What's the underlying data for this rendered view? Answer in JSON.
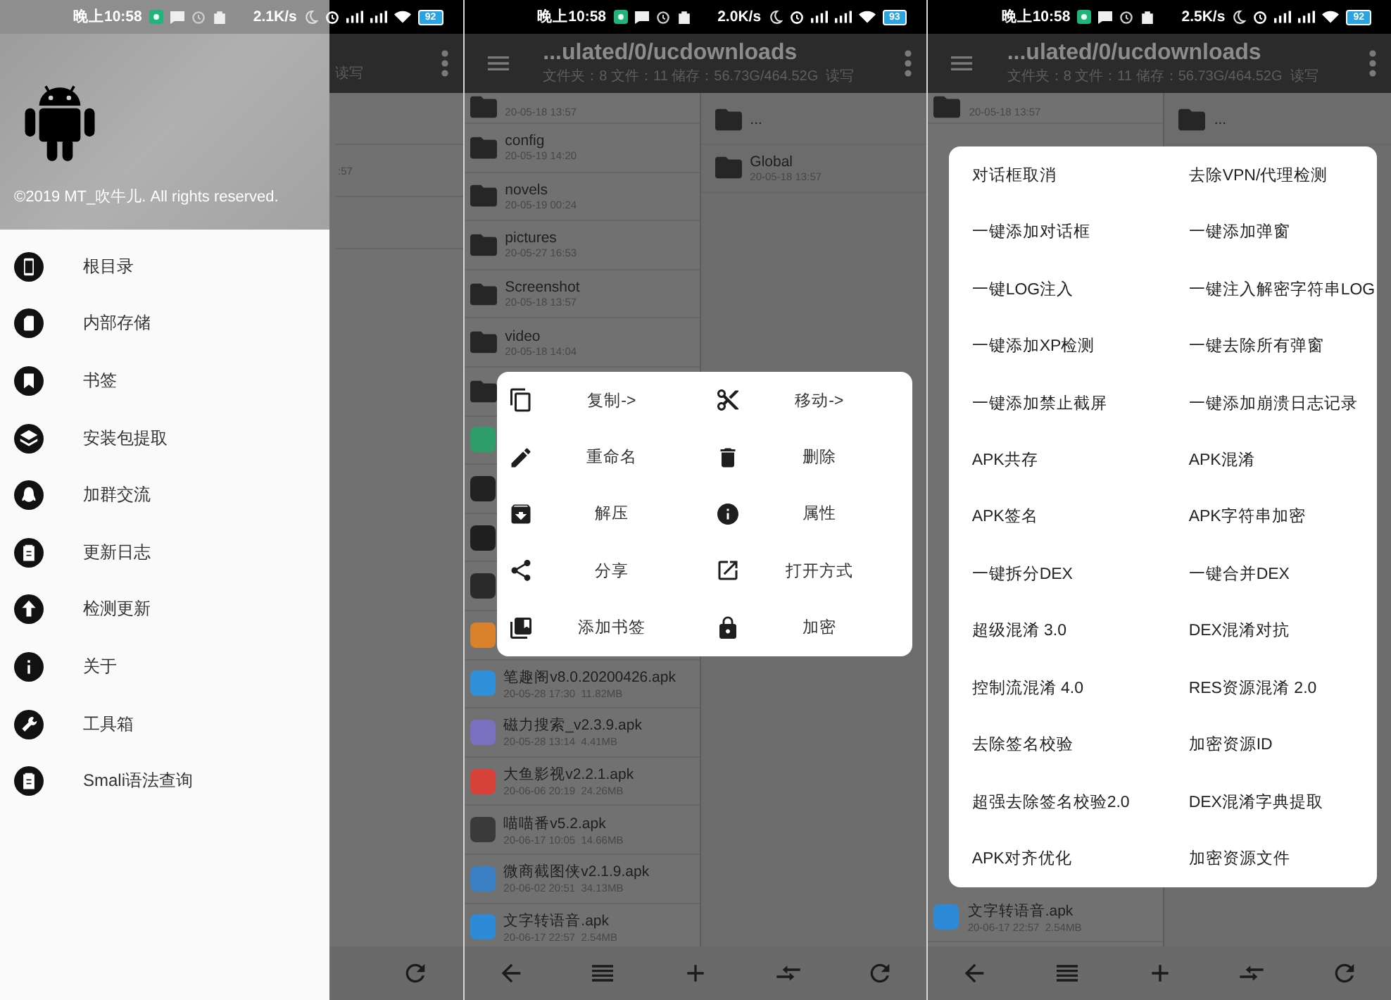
{
  "phones": [
    {
      "kind": "drawer",
      "status_bar": {
        "time": "晚上10:58",
        "speed": "2.1K/s",
        "battery": "92"
      },
      "behind": {
        "subtitle_fragment": "读写",
        "date_fragment": ":57"
      },
      "drawer": {
        "copyright": "©2019 MT_吹牛儿. All rights reserved.",
        "items": [
          {
            "label": "根目录"
          },
          {
            "label": "内部存储"
          },
          {
            "label": "书签"
          },
          {
            "label": "安装包提取"
          },
          {
            "label": "加群交流"
          },
          {
            "label": "更新日志"
          },
          {
            "label": "检测更新"
          },
          {
            "label": "关于"
          },
          {
            "label": "工具箱"
          },
          {
            "label": "Smali语法查询"
          }
        ]
      }
    },
    {
      "kind": "context_menu",
      "status_bar": {
        "time": "晚上10:58",
        "speed": "2.0K/s",
        "battery": "93"
      },
      "app_bar": {
        "title": "...ulated/0/ucdownloads",
        "subtitle": "文件夹：8 文件：11 储存：56.73G/464.52G  读写"
      },
      "left_pane": [
        {
          "kind": "folder",
          "date": "20-05-18 13:57"
        },
        {
          "kind": "folder",
          "name": "config",
          "date": "20-05-19 14:20"
        },
        {
          "kind": "folder",
          "name": "novels",
          "date": "20-05-19 00:24"
        },
        {
          "kind": "folder",
          "name": "pictures",
          "date": "20-05-27 16:53"
        },
        {
          "kind": "folder",
          "name": "Screenshot",
          "date": "20-05-18 13:57"
        },
        {
          "kind": "folder",
          "name": "video",
          "date": "20-05-18 14:04"
        },
        {
          "kind": "folder"
        },
        {
          "kind": "apk",
          "color": "#2e9d6a"
        },
        {
          "kind": "apk",
          "color": "#222222"
        },
        {
          "kind": "apk",
          "color": "#1f1f1f"
        },
        {
          "kind": "apk",
          "color": "#2a2a2a"
        },
        {
          "kind": "apk",
          "color": "#d9822b"
        },
        {
          "kind": "apk",
          "color": "#2f8fd8",
          "name": "笔趣阁v8.0.20200426.apk",
          "date": "20-05-28 17:30  11.82MB"
        },
        {
          "kind": "apk",
          "color": "#7b6fc0",
          "name": "磁力搜索_v2.3.9.apk",
          "date": "20-05-28 13:14  4.41MB"
        },
        {
          "kind": "apk",
          "color": "#d8403a",
          "name": "大鱼影视v2.2.1.apk",
          "date": "20-06-06 20:19  24.26MB"
        },
        {
          "kind": "apk",
          "color": "#3a3a3a",
          "name": "喵喵番v5.2.apk",
          "date": "20-06-17 10:05  14.66MB"
        },
        {
          "kind": "apk",
          "color": "#3b7fc4",
          "name": "微商截图侠v2.1.9.apk",
          "date": "20-06-02 20:51  34.13MB"
        },
        {
          "kind": "apk",
          "color": "#2d8ad6",
          "name": "文字转语音.apk",
          "date": "20-06-17 22:57  2.54MB"
        }
      ],
      "right_pane": [
        {
          "kind": "folder",
          "name": "..."
        },
        {
          "kind": "folder",
          "name": "Global",
          "date": "20-05-18 13:57"
        }
      ],
      "menu": {
        "items": [
          {
            "label": "复制->"
          },
          {
            "label": "移动->"
          },
          {
            "label": "重命名"
          },
          {
            "label": "删除"
          },
          {
            "label": "解压"
          },
          {
            "label": "属性"
          },
          {
            "label": "分享"
          },
          {
            "label": "打开方式"
          },
          {
            "label": "添加书签"
          },
          {
            "label": "加密"
          }
        ]
      }
    },
    {
      "kind": "list_menu",
      "status_bar": {
        "time": "晚上10:58",
        "speed": "2.5K/s",
        "battery": "92"
      },
      "app_bar": {
        "title": "...ulated/0/ucdownloads",
        "subtitle": "文件夹：8 文件：11 储存：56.73G/464.52G  读写"
      },
      "left_pane": [
        {
          "kind": "folder",
          "date": "20-05-18 13:57"
        },
        {
          "kind": "apk",
          "color": "#2d8ad6",
          "name": "文字转语音.apk",
          "date": "20-06-17 22:57  2.54MB"
        }
      ],
      "right_pane": [
        {
          "kind": "folder",
          "name": "..."
        }
      ],
      "menu": {
        "items": [
          {
            "label": "对话框取消"
          },
          {
            "label": "去除VPN/代理检测"
          },
          {
            "label": "一键添加对话框"
          },
          {
            "label": "一键添加弹窗"
          },
          {
            "label": "一键LOG注入"
          },
          {
            "label": "一键注入解密字符串LOG"
          },
          {
            "label": "一键添加XP检测"
          },
          {
            "label": "一键去除所有弹窗"
          },
          {
            "label": "一键添加禁止截屏"
          },
          {
            "label": "一键添加崩溃日志记录"
          },
          {
            "label": "APK共存"
          },
          {
            "label": "APK混淆"
          },
          {
            "label": "APK签名"
          },
          {
            "label": "APK字符串加密"
          },
          {
            "label": "一键拆分DEX"
          },
          {
            "label": "一键合并DEX"
          },
          {
            "label": "超级混淆 3.0"
          },
          {
            "label": "DEX混淆对抗"
          },
          {
            "label": "控制流混淆 4.0"
          },
          {
            "label": "RES资源混淆 2.0"
          },
          {
            "label": "去除签名校验"
          },
          {
            "label": "加密资源ID"
          },
          {
            "label": "超强去除签名校验2.0"
          },
          {
            "label": "DEX混淆字典提取"
          },
          {
            "label": "APK对齐优化"
          },
          {
            "label": "加密资源文件"
          }
        ]
      }
    }
  ]
}
